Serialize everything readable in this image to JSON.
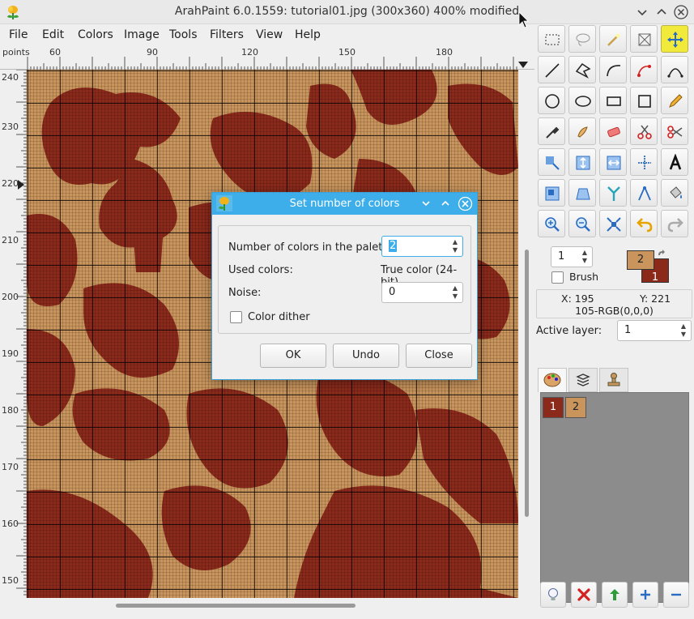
{
  "window": {
    "title": "ArahPaint 6.0.1559: tutorial01.jpg (300x360) 400% modified"
  },
  "menu": [
    "File",
    "Edit",
    "Colors",
    "Image",
    "Tools",
    "Filters",
    "View",
    "Help"
  ],
  "ruler": {
    "unit": "points",
    "top_labels": [
      "60",
      "90",
      "120",
      "150",
      "180"
    ],
    "left_labels": [
      "240",
      "230",
      "220",
      "210",
      "200",
      "190",
      "180",
      "170",
      "160",
      "150"
    ]
  },
  "palette": {
    "color_1": "#8b2a1b",
    "color_2": "#c9955d"
  },
  "tools": [
    "rect-select",
    "lasso",
    "magic-wand",
    "crop",
    "move",
    "line",
    "polygon",
    "curve",
    "shape-edit",
    "bezier",
    "ellipse-outline",
    "ellipse-filled",
    "rectangle-outline",
    "rectangle-filled",
    "pencil",
    "eyedropper",
    "smudge",
    "eraser",
    "cut",
    "scissors",
    "transform",
    "flip-vertical",
    "flip-horizontal",
    "center",
    "text",
    "resize",
    "perspective",
    "fork",
    "compass",
    "bucket",
    "zoom-in",
    "zoom-out",
    "fit",
    "undo",
    "redo"
  ],
  "panel": {
    "brush_size": "1",
    "brush_label": "Brush",
    "color_fg": "2",
    "color_bg": "1",
    "x_label": "X: 195",
    "y_label": "Y: 221",
    "color_info": "105-RGB(0,0,0)",
    "active_layer_label": "Active layer:",
    "active_layer": "1",
    "layers": [
      "1",
      "2"
    ]
  },
  "dialog": {
    "title": "Set number of colors",
    "palette_label": "Number of colors in the palette:",
    "palette_value": "2",
    "used_label": "Used colors:",
    "used_value": "True color (24-bit)",
    "noise_label": "Noise:",
    "noise_value": "0",
    "dither_label": "Color dither",
    "ok": "OK",
    "undo": "Undo",
    "close": "Close"
  }
}
